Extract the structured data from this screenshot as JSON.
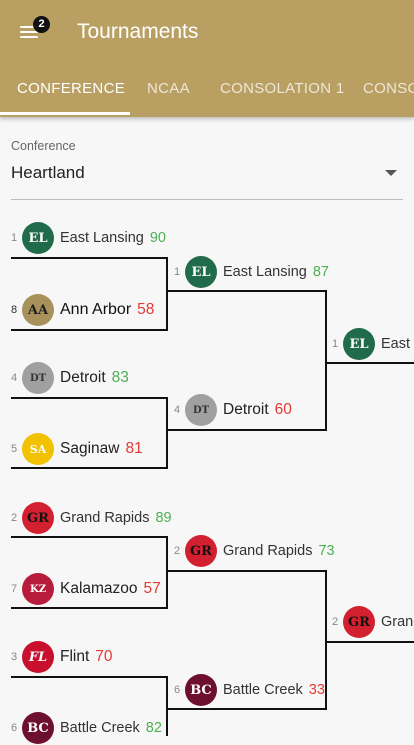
{
  "appbar": {
    "title": "Tournaments",
    "badge_count": "2",
    "bg_color": "#b9a062"
  },
  "tabs": [
    {
      "label": "CONFERENCE",
      "active": true
    },
    {
      "label": "NCAA",
      "active": false
    },
    {
      "label": "CONSOLATION 1",
      "active": false
    },
    {
      "label": "CONSO",
      "active": false
    }
  ],
  "filter": {
    "label": "Conference",
    "value": "Heartland"
  },
  "colors": {
    "win": "#4caf50",
    "lose": "#e53935"
  },
  "bracket": {
    "round1": [
      {
        "seed": "1",
        "abbr": "EL",
        "name": "East Lansing",
        "score": "90",
        "result": "win",
        "logo_color": "#1f6b4a"
      },
      {
        "seed": "8",
        "abbr": "AA",
        "name": "Ann Arbor",
        "score": "58",
        "result": "lose",
        "logo_color": "#a8915a"
      },
      {
        "seed": "4",
        "abbr": "DT",
        "name": "Detroit",
        "score": "83",
        "result": "win",
        "logo_color": "#a0a0a0"
      },
      {
        "seed": "5",
        "abbr": "SA",
        "name": "Saginaw",
        "score": "81",
        "result": "lose",
        "logo_color": "#f2c200"
      },
      {
        "seed": "2",
        "abbr": "GR",
        "name": "Grand Rapids",
        "score": "89",
        "result": "win",
        "logo_color": "#d32030"
      },
      {
        "seed": "7",
        "abbr": "KZ",
        "name": "Kalamazoo",
        "score": "57",
        "result": "lose",
        "logo_color": "#b81c3c"
      },
      {
        "seed": "3",
        "abbr": "FL",
        "name": "Flint",
        "score": "70",
        "result": "lose",
        "logo_color": "#c8102e"
      },
      {
        "seed": "6",
        "abbr": "BC",
        "name": "Battle Creek",
        "score": "82",
        "result": "win",
        "logo_color": "#6d1030"
      }
    ],
    "round2": [
      {
        "seed": "1",
        "abbr": "EL",
        "name": "East Lansing",
        "score": "87",
        "result": "win",
        "logo_color": "#1f6b4a"
      },
      {
        "seed": "4",
        "abbr": "DT",
        "name": "Detroit",
        "score": "60",
        "result": "lose",
        "logo_color": "#a0a0a0"
      },
      {
        "seed": "2",
        "abbr": "GR",
        "name": "Grand Rapids",
        "score": "73",
        "result": "win",
        "logo_color": "#d32030"
      },
      {
        "seed": "6",
        "abbr": "BC",
        "name": "Battle Creek",
        "score": "33",
        "result": "lose",
        "logo_color": "#6d1030"
      }
    ],
    "round3": [
      {
        "seed": "1",
        "abbr": "EL",
        "name": "East L",
        "logo_color": "#1f6b4a"
      },
      {
        "seed": "2",
        "abbr": "GR",
        "name": "Grand",
        "logo_color": "#d32030"
      }
    ]
  }
}
